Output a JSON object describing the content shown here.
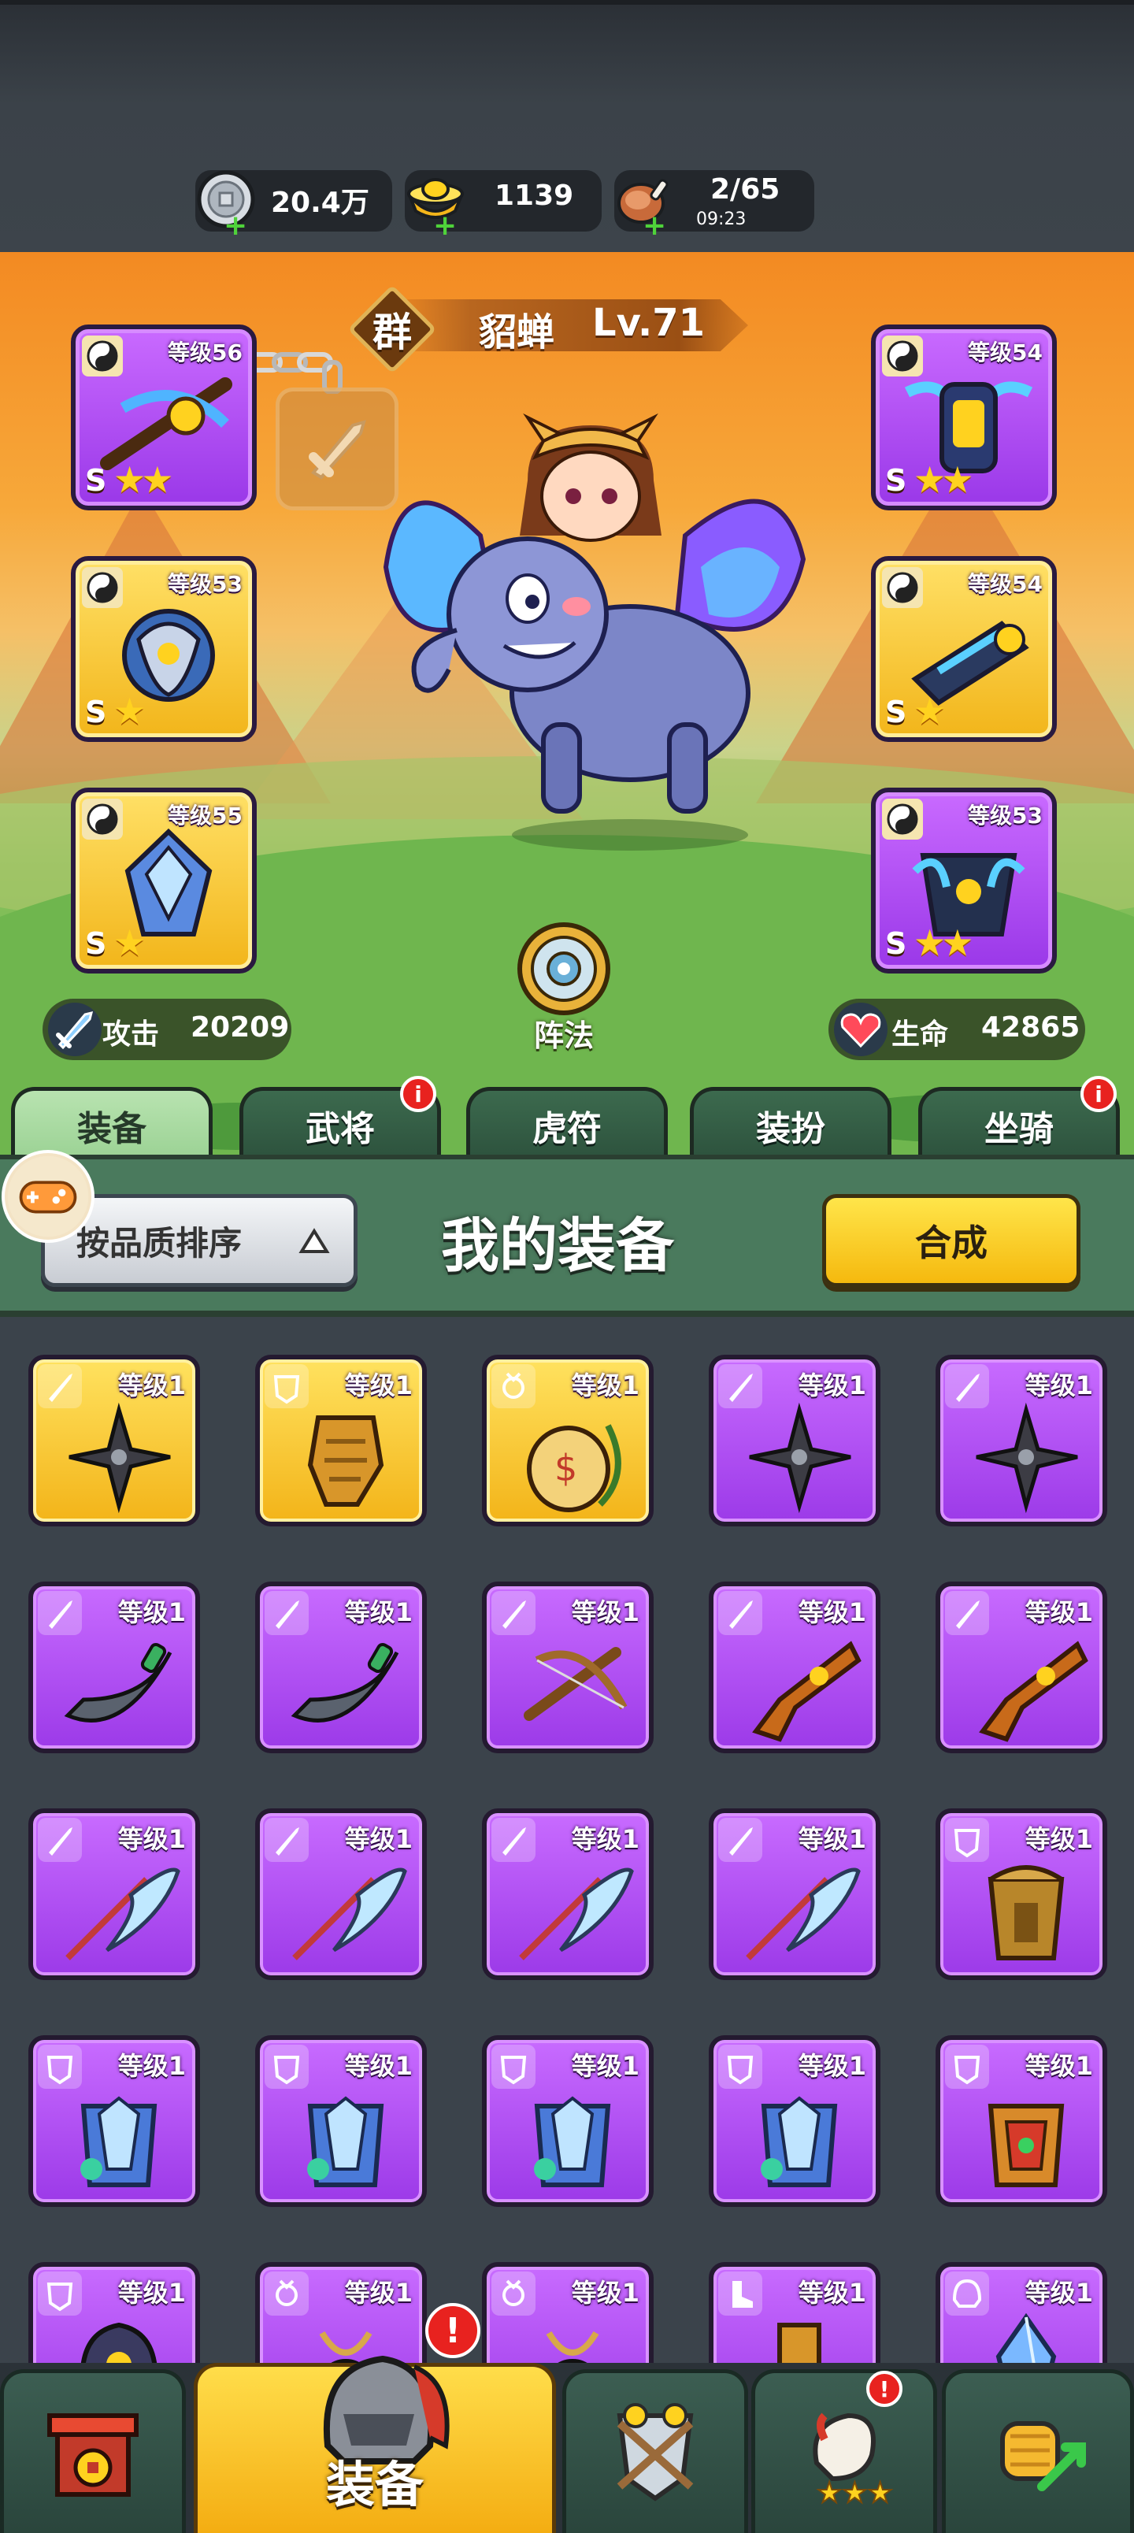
{
  "resources": [
    {
      "icon": "silver-coin-icon",
      "value": "20.4万"
    },
    {
      "icon": "gold-ingot-icon",
      "value": "1139"
    },
    {
      "icon": "meat-icon",
      "value": "2/65",
      "timer": "09:23"
    }
  ],
  "hero": {
    "faction": "群",
    "name": "貂蝉",
    "level": "Lv.71",
    "formation_label": "阵法",
    "attack_label": "攻击",
    "attack_value": "20209",
    "hp_label": "生命",
    "hp_value": "42865"
  },
  "equipped": [
    {
      "level": "等级56",
      "rarity": "purple",
      "grade": "S",
      "stars": "★★"
    },
    {
      "level": "等级53",
      "rarity": "gold",
      "grade": "S",
      "stars": "★"
    },
    {
      "level": "等级55",
      "rarity": "gold",
      "grade": "S",
      "stars": "★"
    },
    {
      "level": "等级54",
      "rarity": "purple",
      "grade": "S",
      "stars": "★★"
    },
    {
      "level": "等级54",
      "rarity": "gold",
      "grade": "S",
      "stars": "★"
    },
    {
      "level": "等级53",
      "rarity": "purple",
      "grade": "S",
      "stars": "★★"
    }
  ],
  "tabs": [
    {
      "label": "装备",
      "badge": ""
    },
    {
      "label": "武将",
      "badge": "i"
    },
    {
      "label": "虎符",
      "badge": ""
    },
    {
      "label": "装扮",
      "badge": ""
    },
    {
      "label": "坐骑",
      "badge": "i"
    }
  ],
  "equip_header": {
    "sort_label": "按品质排序",
    "title": "我的装备",
    "combine_label": "合成"
  },
  "inventory": [
    {
      "level": "等级1",
      "rarity": "gold",
      "type": "weapon",
      "item": "shuriken"
    },
    {
      "level": "等级1",
      "rarity": "gold",
      "type": "armor",
      "item": "gauntlet"
    },
    {
      "level": "等级1",
      "rarity": "gold",
      "type": "accessory",
      "item": "pouch"
    },
    {
      "level": "等级1",
      "rarity": "purple",
      "type": "weapon",
      "item": "shuriken"
    },
    {
      "level": "等级1",
      "rarity": "purple",
      "type": "weapon",
      "item": "shuriken"
    },
    {
      "level": "等级1",
      "rarity": "purple",
      "type": "weapon",
      "item": "scimitar"
    },
    {
      "level": "等级1",
      "rarity": "purple",
      "type": "weapon",
      "item": "scimitar"
    },
    {
      "level": "等级1",
      "rarity": "purple",
      "type": "weapon",
      "item": "crossbow"
    },
    {
      "level": "等级1",
      "rarity": "purple",
      "type": "weapon",
      "item": "pistol"
    },
    {
      "level": "等级1",
      "rarity": "purple",
      "type": "weapon",
      "item": "pistol"
    },
    {
      "level": "等级1",
      "rarity": "purple",
      "type": "weapon",
      "item": "glaive"
    },
    {
      "level": "等级1",
      "rarity": "purple",
      "type": "weapon",
      "item": "glaive"
    },
    {
      "level": "等级1",
      "rarity": "purple",
      "type": "weapon",
      "item": "glaive"
    },
    {
      "level": "等级1",
      "rarity": "purple",
      "type": "weapon",
      "item": "glaive"
    },
    {
      "level": "等级1",
      "rarity": "purple",
      "type": "armor",
      "item": "gold-armor"
    },
    {
      "level": "等级1",
      "rarity": "purple",
      "type": "armor",
      "item": "blue-armor"
    },
    {
      "level": "等级1",
      "rarity": "purple",
      "type": "armor",
      "item": "blue-armor"
    },
    {
      "level": "等级1",
      "rarity": "purple",
      "type": "armor",
      "item": "blue-armor"
    },
    {
      "level": "等级1",
      "rarity": "purple",
      "type": "armor",
      "item": "blue-armor"
    },
    {
      "level": "等级1",
      "rarity": "purple",
      "type": "armor",
      "item": "red-armor"
    },
    {
      "level": "等级1",
      "rarity": "purple",
      "type": "armor",
      "item": "helm"
    },
    {
      "level": "等级1",
      "rarity": "purple",
      "type": "accessory",
      "item": "amulet"
    },
    {
      "level": "等级1",
      "rarity": "purple",
      "type": "accessory",
      "item": "amulet"
    },
    {
      "level": "等级1",
      "rarity": "purple",
      "type": "boots",
      "item": "boot"
    },
    {
      "level": "等级1",
      "rarity": "purple",
      "type": "helmet",
      "item": "crystal"
    }
  ],
  "bottom_nav": [
    {
      "label": "",
      "icon": "fortress-icon",
      "badge": ""
    },
    {
      "label": "装备",
      "icon": "helmet-icon",
      "badge": "!"
    },
    {
      "label": "",
      "icon": "battle-shield-icon",
      "badge": ""
    },
    {
      "label": "",
      "icon": "chicken-leg-icon",
      "badge": "!"
    },
    {
      "label": "",
      "icon": "fist-icon",
      "badge": ""
    }
  ],
  "colors": {
    "purple_tile": "#a544ee",
    "gold_tile": "#f6c630",
    "active_tab": "#a8d9a0",
    "header_green": "#4a7a5d",
    "badge_red": "#e8221f"
  }
}
